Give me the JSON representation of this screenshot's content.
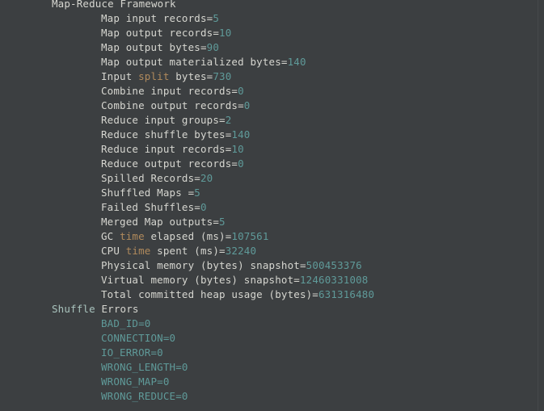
{
  "console": {
    "app": "terminal-console",
    "background_color": "#3c3f41",
    "text_color": "#d6d6d0",
    "number_color": "#5f9a99",
    "keyword_color": "#b08a5c",
    "group_color": "#a9c3bd",
    "clipped_top_line": "Reduce Framework",
    "lines": [
      {
        "indent": "group",
        "segments": [
          {
            "text": "Map-Reduce Framework",
            "kind": "text"
          }
        ]
      },
      {
        "indent": "entry",
        "segments": [
          {
            "text": "Map input records=",
            "kind": "text"
          },
          {
            "text": "5",
            "kind": "num"
          }
        ]
      },
      {
        "indent": "entry",
        "segments": [
          {
            "text": "Map output records=",
            "kind": "text"
          },
          {
            "text": "10",
            "kind": "num"
          }
        ]
      },
      {
        "indent": "entry",
        "segments": [
          {
            "text": "Map output bytes=",
            "kind": "text"
          },
          {
            "text": "90",
            "kind": "num"
          }
        ]
      },
      {
        "indent": "entry",
        "segments": [
          {
            "text": "Map output materialized bytes=",
            "kind": "text"
          },
          {
            "text": "140",
            "kind": "num"
          }
        ]
      },
      {
        "indent": "entry",
        "segments": [
          {
            "text": "Input ",
            "kind": "text"
          },
          {
            "text": "split",
            "kind": "kw"
          },
          {
            "text": " bytes=",
            "kind": "text"
          },
          {
            "text": "730",
            "kind": "num"
          }
        ]
      },
      {
        "indent": "entry",
        "segments": [
          {
            "text": "Combine input records=",
            "kind": "text"
          },
          {
            "text": "0",
            "kind": "num"
          }
        ]
      },
      {
        "indent": "entry",
        "segments": [
          {
            "text": "Combine output records=",
            "kind": "text"
          },
          {
            "text": "0",
            "kind": "num"
          }
        ]
      },
      {
        "indent": "entry",
        "segments": [
          {
            "text": "Reduce input groups=",
            "kind": "text"
          },
          {
            "text": "2",
            "kind": "num"
          }
        ]
      },
      {
        "indent": "entry",
        "segments": [
          {
            "text": "Reduce shuffle bytes=",
            "kind": "text"
          },
          {
            "text": "140",
            "kind": "num"
          }
        ]
      },
      {
        "indent": "entry",
        "segments": [
          {
            "text": "Reduce input records=",
            "kind": "text"
          },
          {
            "text": "10",
            "kind": "num"
          }
        ]
      },
      {
        "indent": "entry",
        "segments": [
          {
            "text": "Reduce output records=",
            "kind": "text"
          },
          {
            "text": "0",
            "kind": "num"
          }
        ]
      },
      {
        "indent": "entry",
        "segments": [
          {
            "text": "Spilled Records=",
            "kind": "text"
          },
          {
            "text": "20",
            "kind": "num"
          }
        ]
      },
      {
        "indent": "entry",
        "segments": [
          {
            "text": "Shuffled Maps =",
            "kind": "text"
          },
          {
            "text": "5",
            "kind": "num"
          }
        ]
      },
      {
        "indent": "entry",
        "segments": [
          {
            "text": "Failed Shuffles=",
            "kind": "text"
          },
          {
            "text": "0",
            "kind": "num"
          }
        ]
      },
      {
        "indent": "entry",
        "segments": [
          {
            "text": "Merged Map outputs=",
            "kind": "text"
          },
          {
            "text": "5",
            "kind": "num"
          }
        ]
      },
      {
        "indent": "entry",
        "segments": [
          {
            "text": "GC ",
            "kind": "text"
          },
          {
            "text": "time",
            "kind": "kw"
          },
          {
            "text": " elapsed (ms)=",
            "kind": "text"
          },
          {
            "text": "107561",
            "kind": "num"
          }
        ]
      },
      {
        "indent": "entry",
        "segments": [
          {
            "text": "CPU ",
            "kind": "text"
          },
          {
            "text": "time",
            "kind": "kw"
          },
          {
            "text": " spent (ms)=",
            "kind": "text"
          },
          {
            "text": "32240",
            "kind": "num"
          }
        ]
      },
      {
        "indent": "entry",
        "segments": [
          {
            "text": "Physical memory (bytes) snapshot=",
            "kind": "text"
          },
          {
            "text": "500453376",
            "kind": "num"
          }
        ]
      },
      {
        "indent": "entry",
        "segments": [
          {
            "text": "Virtual memory (bytes) snapshot=",
            "kind": "text"
          },
          {
            "text": "12460331008",
            "kind": "num"
          }
        ]
      },
      {
        "indent": "entry",
        "segments": [
          {
            "text": "Total committed heap usage (bytes)=",
            "kind": "text"
          },
          {
            "text": "631316480",
            "kind": "num"
          }
        ]
      },
      {
        "indent": "group",
        "segments": [
          {
            "text": "Shuffle",
            "kind": "group"
          },
          {
            "text": " Errors",
            "kind": "text"
          }
        ]
      },
      {
        "indent": "entry",
        "segments": [
          {
            "text": "BAD_ID=0",
            "kind": "num"
          }
        ]
      },
      {
        "indent": "entry",
        "segments": [
          {
            "text": "CONNECTION=0",
            "kind": "num"
          }
        ]
      },
      {
        "indent": "entry",
        "segments": [
          {
            "text": "IO_ERROR=0",
            "kind": "num"
          }
        ]
      },
      {
        "indent": "entry",
        "segments": [
          {
            "text": "WRONG_LENGTH=0",
            "kind": "num"
          }
        ]
      },
      {
        "indent": "entry",
        "segments": [
          {
            "text": "WRONG_MAP=0",
            "kind": "num"
          }
        ]
      },
      {
        "indent": "entry",
        "segments": [
          {
            "text": "WRONG_REDUCE=0",
            "kind": "num"
          }
        ]
      }
    ]
  }
}
